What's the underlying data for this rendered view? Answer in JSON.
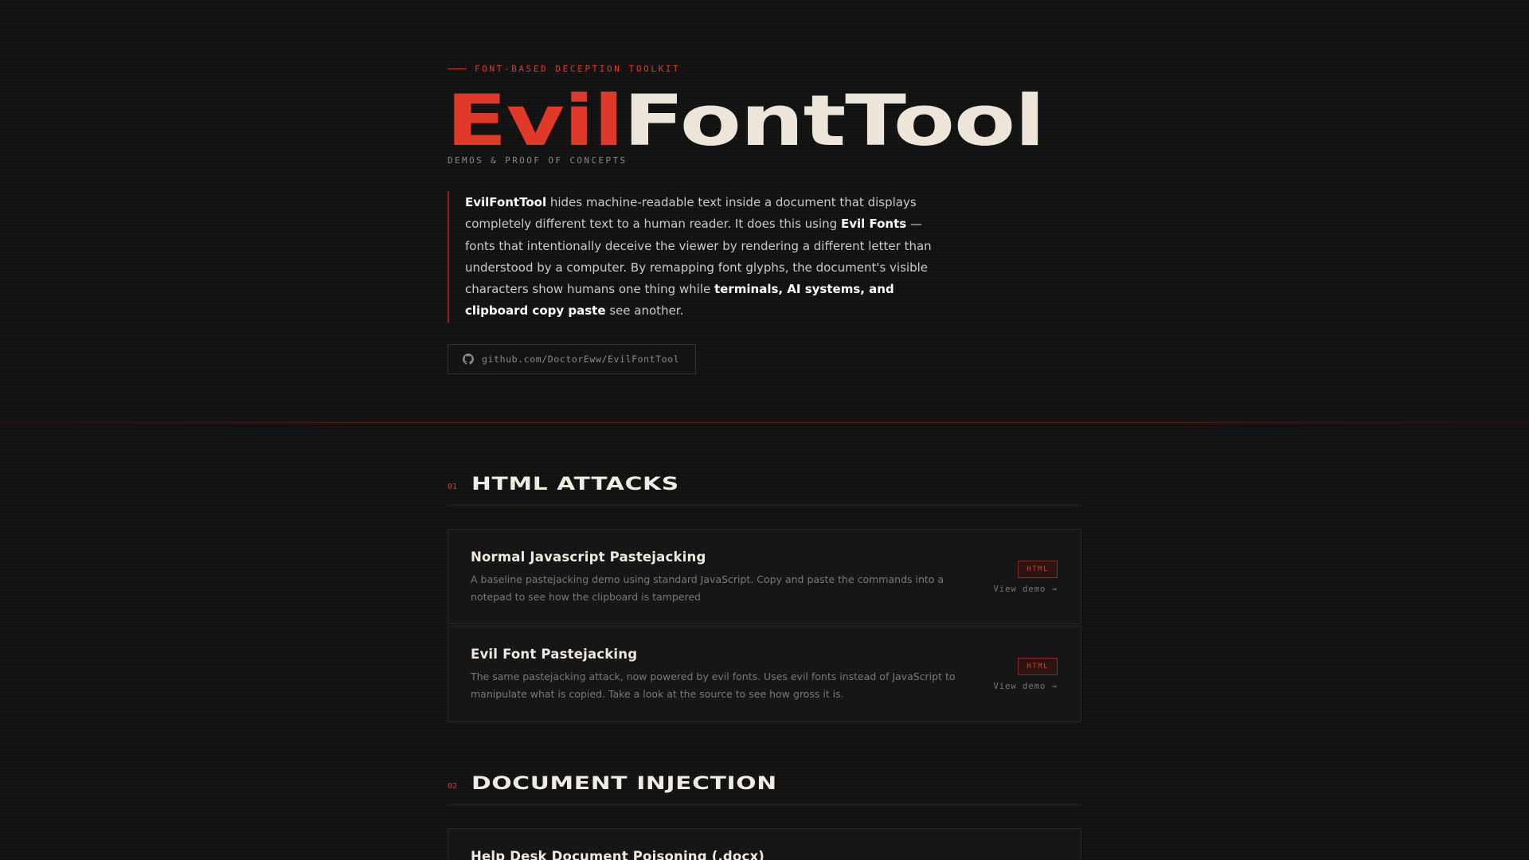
{
  "header": {
    "eyebrow": "FONT-BASED DECEPTION TOOLKIT",
    "title_part1": "Evil",
    "title_part2": "FontTool",
    "subtitle": "DEMOS & PROOF OF CONCEPTS"
  },
  "intro": {
    "t1_bold": "EvilFontTool",
    "t2": " hides machine-readable text inside a document that displays completely different text to a human reader. It does this using ",
    "t3_bold": "Evil Fonts",
    "t4": " — fonts that intentionally deceive the viewer by rendering a different letter than understood by a computer. By remapping font glyphs, the document's visible characters show humans one thing while ",
    "t5_bold": "terminals, AI systems, and clipboard copy paste",
    "t6": " see another."
  },
  "repo": {
    "icon": "github-icon",
    "label": "github.com/DoctorEww/EvilFontTool"
  },
  "sections": [
    {
      "num": "01",
      "title": "HTML ATTACKS",
      "cards": [
        {
          "title": "Normal Javascript Pastejacking",
          "desc": "A baseline pastejacking demo using standard JavaScript. Copy and paste the commands into a notepad to see how the clipboard is tampered",
          "badge": "HTML",
          "link": "View demo →"
        },
        {
          "title": "Evil Font Pastejacking",
          "desc": "The same pastejacking attack, now powered by evil fonts. Uses evil fonts instead of JavaScript to manipulate what is copied. Take a look at the source to see how gross it is.",
          "badge": "HTML",
          "link": "View demo →"
        }
      ]
    },
    {
      "num": "02",
      "title": "DOCUMENT INJECTION",
      "cards": [
        {
          "title": "Help Desk Document Poisoning (.docx)"
        }
      ]
    }
  ],
  "colors": {
    "accent": "#e0392a",
    "background": "#111111",
    "heading": "#ece5d8"
  }
}
